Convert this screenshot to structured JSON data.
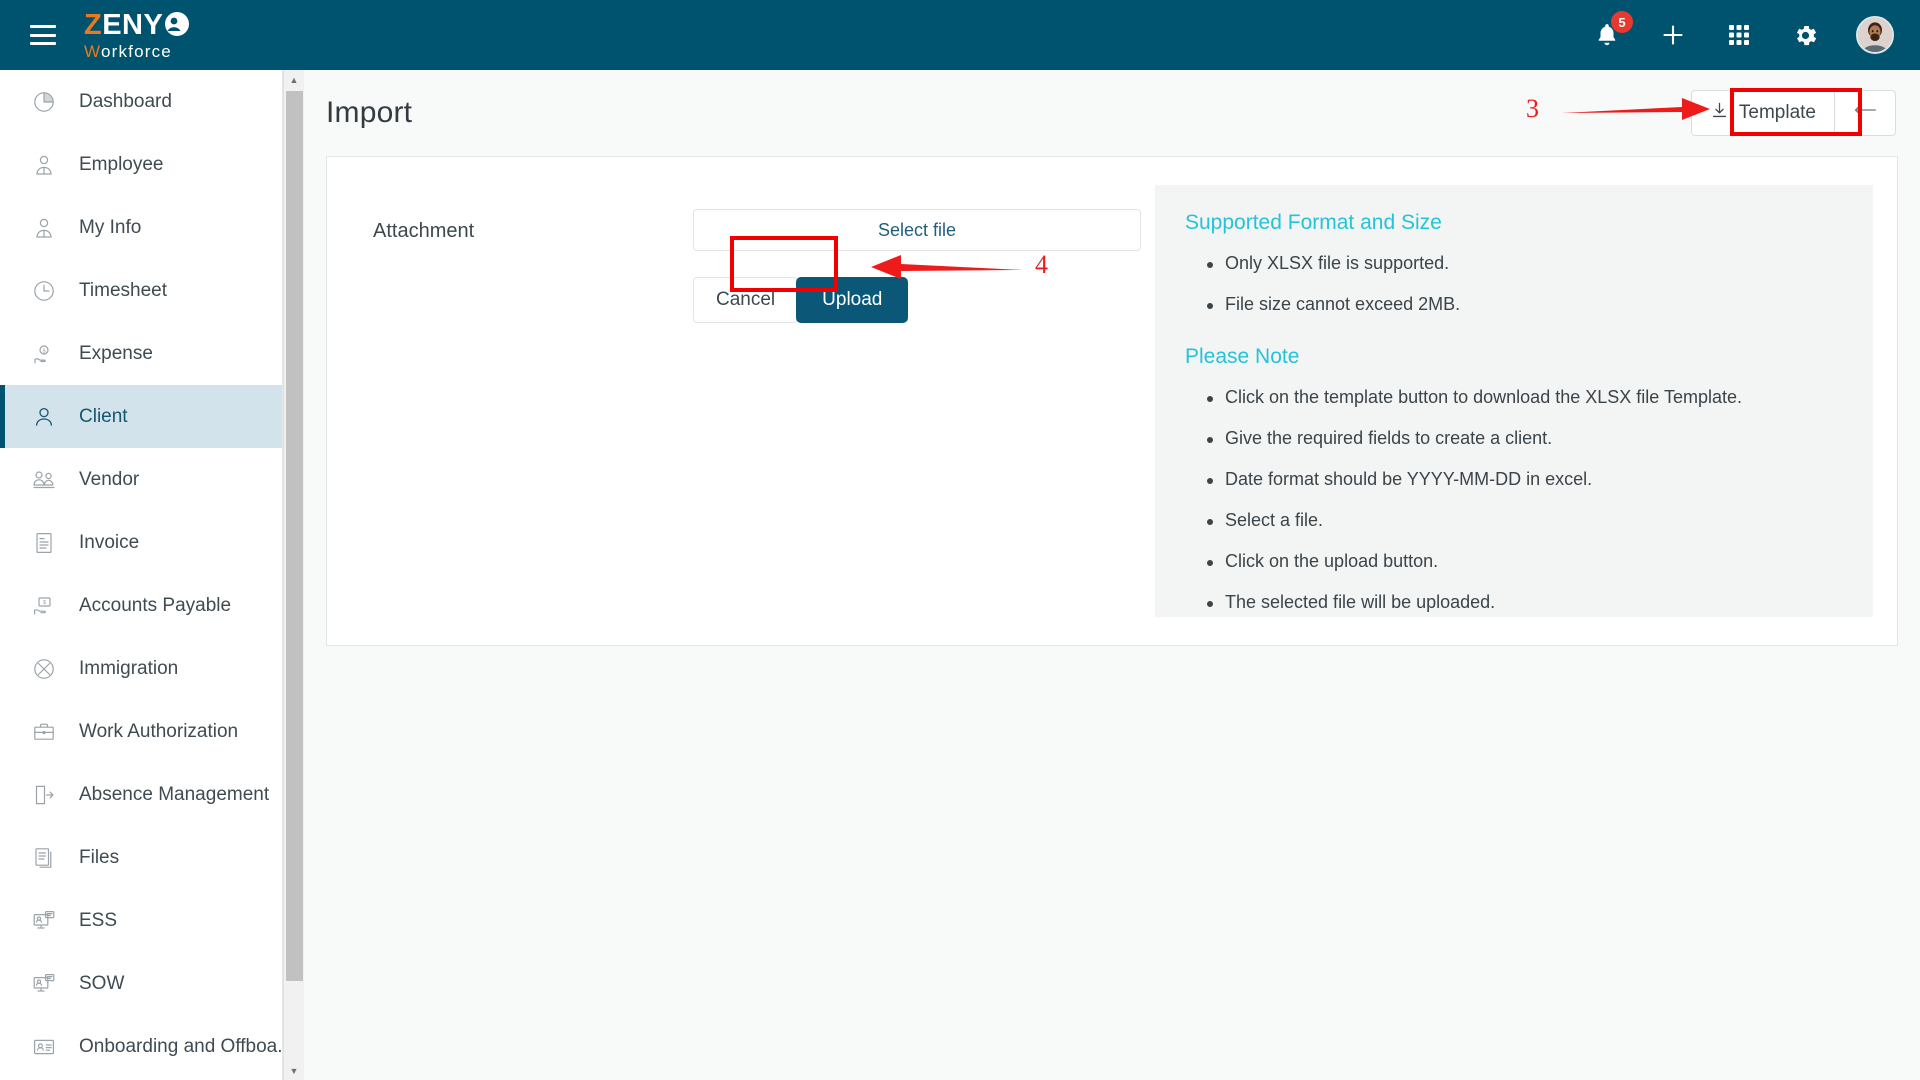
{
  "brand": {
    "z": "Z",
    "eny": "ENY",
    "w": "W",
    "orkforce": "orkforce",
    "full_name": "ZENYO Workforce",
    "accent_orange": "#e8791e",
    "topbar_color": "#00536f"
  },
  "topbar": {
    "menu_icon": "hamburger-icon",
    "notification_count": "5",
    "icons": [
      "bell-icon",
      "plus-icon",
      "apps-grid-icon",
      "gear-icon",
      "avatar"
    ]
  },
  "sidebar": {
    "items": [
      {
        "label": "Dashboard",
        "icon": "pie-chart-icon",
        "active": false
      },
      {
        "label": "Employee",
        "icon": "employee-icon",
        "active": false
      },
      {
        "label": "My Info",
        "icon": "my-info-icon",
        "active": false
      },
      {
        "label": "Timesheet",
        "icon": "clock-icon",
        "active": false
      },
      {
        "label": "Expense",
        "icon": "expense-hand-money-icon",
        "active": false
      },
      {
        "label": "Client",
        "icon": "person-icon",
        "active": true
      },
      {
        "label": "Vendor",
        "icon": "vendor-people-icon",
        "active": false
      },
      {
        "label": "Invoice",
        "icon": "invoice-receipt-icon",
        "active": false
      },
      {
        "label": "Accounts Payable",
        "icon": "accounts-payable-icon",
        "active": false
      },
      {
        "label": "Immigration",
        "icon": "immigration-globe-icon",
        "active": false
      },
      {
        "label": "Work Authorization",
        "icon": "briefcase-icon",
        "active": false
      },
      {
        "label": "Absence Management",
        "icon": "door-exit-icon",
        "active": false
      },
      {
        "label": "Files",
        "icon": "files-icon",
        "active": false
      },
      {
        "label": "ESS",
        "icon": "ess-monitor-icon",
        "active": false
      },
      {
        "label": "SOW",
        "icon": "sow-monitor-icon",
        "active": false
      },
      {
        "label": "Onboarding and Offboa...",
        "icon": "id-card-icon",
        "active": false
      }
    ],
    "active_bg": "#d2e3ec",
    "active_border": "#00536f"
  },
  "page": {
    "title": "Import",
    "template_button": "Template",
    "template_icon": "download-icon",
    "back_icon": "arrow-left-icon"
  },
  "form": {
    "attachment_label": "Attachment",
    "select_file_label": "Select file",
    "cancel_label": "Cancel",
    "upload_label": "Upload",
    "upload_color": "#0b5778"
  },
  "info": {
    "heading_color": "#24c3d9",
    "format_heading": "Supported Format and Size",
    "format_items": [
      "Only XLSX file is supported.",
      "File size cannot exceed 2MB."
    ],
    "note_heading": "Please Note",
    "note_items": [
      "Click on the template button to download the XLSX file Template.",
      "Give the required fields to create a client.",
      "Date format should be YYYY-MM-DD in excel.",
      "Select a file.",
      "Click on the upload button.",
      "The selected file will be uploaded."
    ]
  },
  "annotations": {
    "color": "#ee1b1b",
    "step3": "3",
    "step4": "4"
  }
}
